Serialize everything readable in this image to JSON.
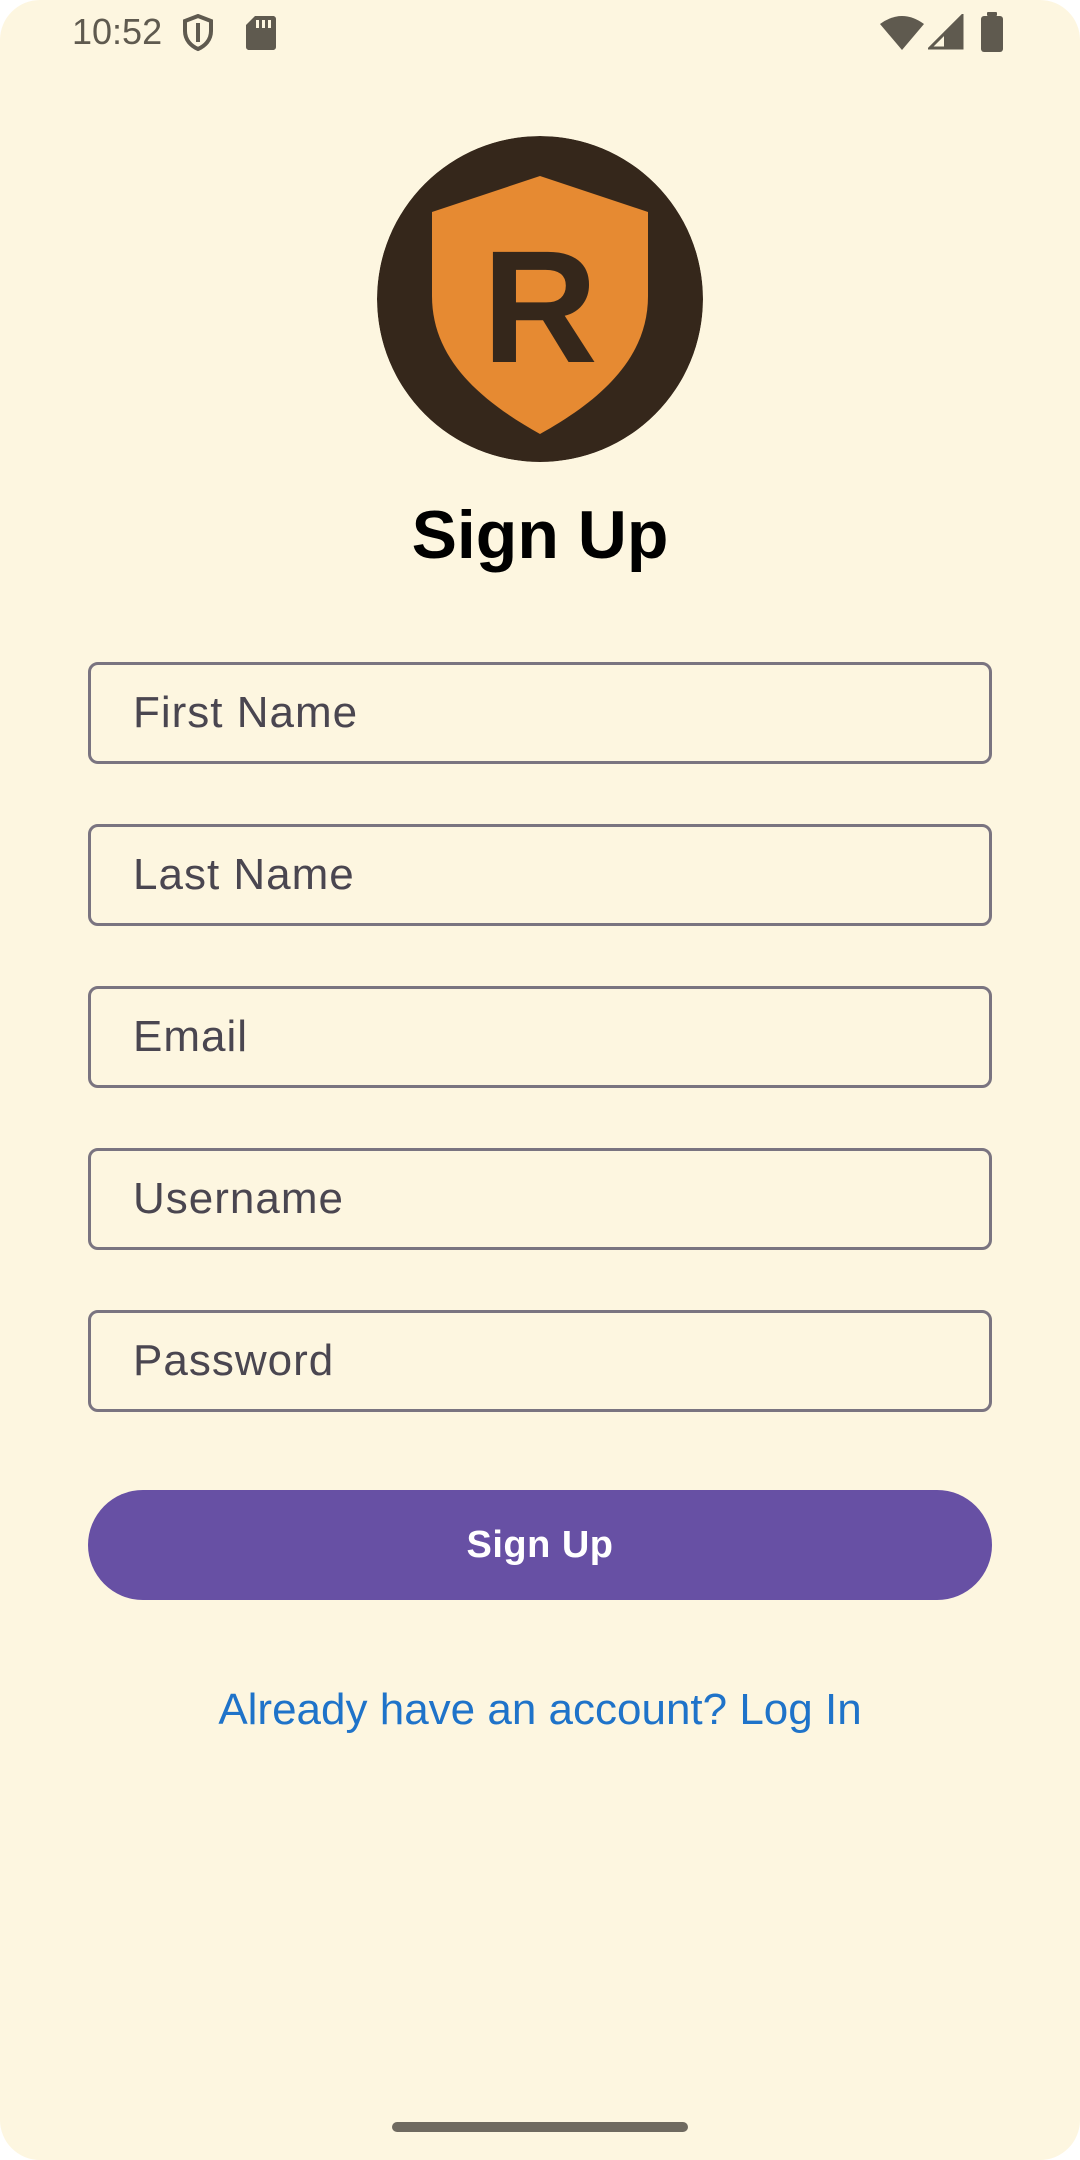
{
  "status_bar": {
    "time": "10:52",
    "icons": [
      "shield-icon",
      "sd-card-icon",
      "wifi-icon",
      "signal-icon",
      "battery-icon"
    ]
  },
  "logo": {
    "letter": "R",
    "colors": {
      "circle": "#35271B",
      "shield": "#E68A32",
      "letter": "#35271B"
    }
  },
  "title": "Sign Up",
  "form": {
    "first_name": {
      "placeholder": "First Name",
      "value": ""
    },
    "last_name": {
      "placeholder": "Last Name",
      "value": ""
    },
    "email": {
      "placeholder": "Email",
      "value": ""
    },
    "username": {
      "placeholder": "Username",
      "value": ""
    },
    "password": {
      "placeholder": "Password",
      "value": ""
    }
  },
  "signup_button": {
    "label": "Sign Up"
  },
  "login_link": {
    "label": "Already have an account? Log In"
  },
  "theme": {
    "background": "#FDF6E0",
    "accent": "#6750A4",
    "link": "#1F73C9",
    "field_border": "#7A7480"
  }
}
